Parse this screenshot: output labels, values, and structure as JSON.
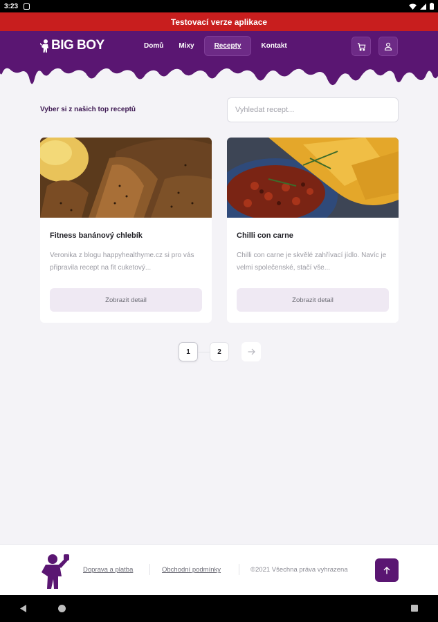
{
  "status": {
    "time": "3:23"
  },
  "test_banner": "Testovací verze aplikace",
  "header": {
    "logo": "BIG BOY",
    "nav": [
      "Domů",
      "Mixy",
      "Recepty",
      "Kontakt"
    ],
    "active_nav": "Recepty"
  },
  "main": {
    "section_title": "Vyber si z našich top receptů",
    "search": {
      "placeholder": "Vyhledat recept...",
      "value": ""
    },
    "recipes": [
      {
        "title": "Fitness banánový chlebík",
        "description": "Veronika z blogu happyhealthyme.cz si pro vás připravila recept na fit cuketový...",
        "button": "Zobrazit detail"
      },
      {
        "title": "Chilli con carne",
        "description": "Chilli con carne je skvělé zahřívací jídlo. Navíc je velmi společenské, stačí vše...",
        "button": "Zobrazit detail"
      }
    ],
    "pagination": {
      "pages": [
        "1",
        "2"
      ],
      "current": "1"
    }
  },
  "footer": {
    "links": [
      "Doprava a platba",
      "Obchodní podmínky"
    ],
    "copyright": "©2021 Všechna práva vyhrazena"
  },
  "colors": {
    "brand": "#5a1672",
    "test_banner": "#c81e1e",
    "background": "#f4f3f7"
  }
}
